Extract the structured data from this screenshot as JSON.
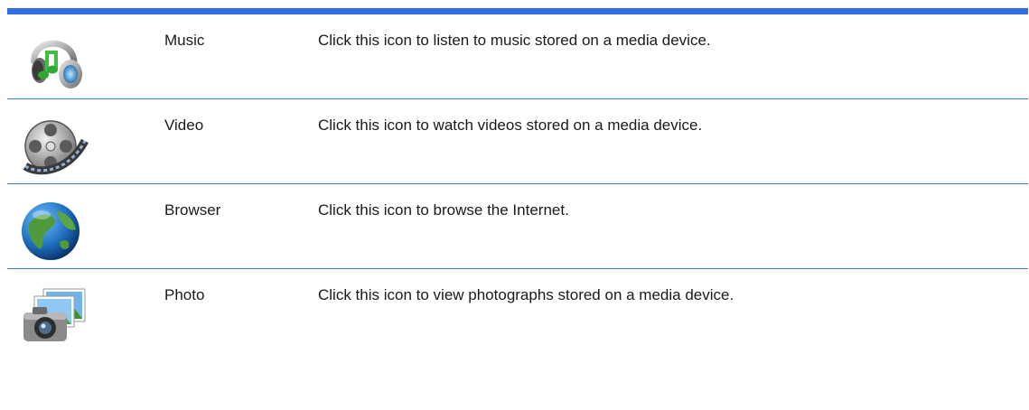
{
  "accent_color": "#2f6fe0",
  "rows": [
    {
      "icon": "headphones-music-icon",
      "name": "Music",
      "description": "Click this icon to listen to music stored on a media device."
    },
    {
      "icon": "film-reel-video-icon",
      "name": "Video",
      "description": "Click this icon to watch videos stored on a media device."
    },
    {
      "icon": "globe-browser-icon",
      "name": "Browser",
      "description": "Click this icon to browse the Internet."
    },
    {
      "icon": "camera-photo-icon",
      "name": "Photo",
      "description": "Click this icon to view photographs stored on a media device."
    }
  ]
}
